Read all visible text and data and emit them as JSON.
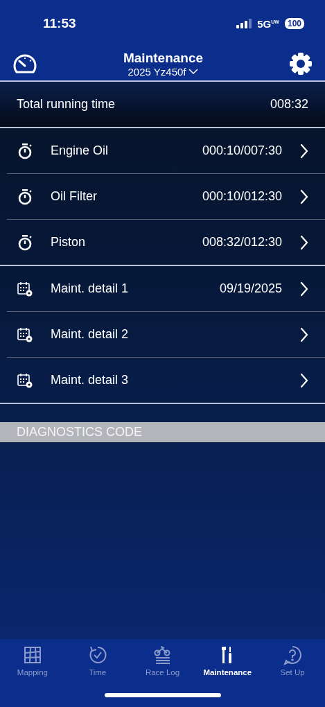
{
  "status_bar": {
    "time": "11:53",
    "network": "5G",
    "network_sub": "UW",
    "battery": "100"
  },
  "header": {
    "title": "Maintenance",
    "subtitle": "2025 Yz450f"
  },
  "total": {
    "label": "Total running time",
    "value": "008:32"
  },
  "groups": [
    {
      "items": [
        {
          "kind": "timer",
          "label": "Engine Oil",
          "value": "000:10/007:30"
        },
        {
          "kind": "timer",
          "label": "Oil Filter",
          "value": "000:10/012:30"
        },
        {
          "kind": "timer",
          "label": "Piston",
          "value": "008:32/012:30"
        }
      ]
    },
    {
      "items": [
        {
          "kind": "calendar",
          "label": "Maint. detail 1",
          "value": "09/19/2025"
        },
        {
          "kind": "calendar",
          "label": "Maint. detail 2"
        },
        {
          "kind": "calendar",
          "label": "Maint. detail 3"
        }
      ]
    }
  ],
  "section": {
    "title": "DIAGNOSTICS CODE"
  },
  "tabs": [
    {
      "kind": "map",
      "label": "Mapping",
      "selected": false
    },
    {
      "kind": "time",
      "label": "Time",
      "selected": false
    },
    {
      "kind": "log",
      "label": "Race Log",
      "selected": false
    },
    {
      "kind": "tools",
      "label": "Maintenance",
      "selected": true
    },
    {
      "kind": "help",
      "label": "Set Up",
      "selected": false
    }
  ]
}
